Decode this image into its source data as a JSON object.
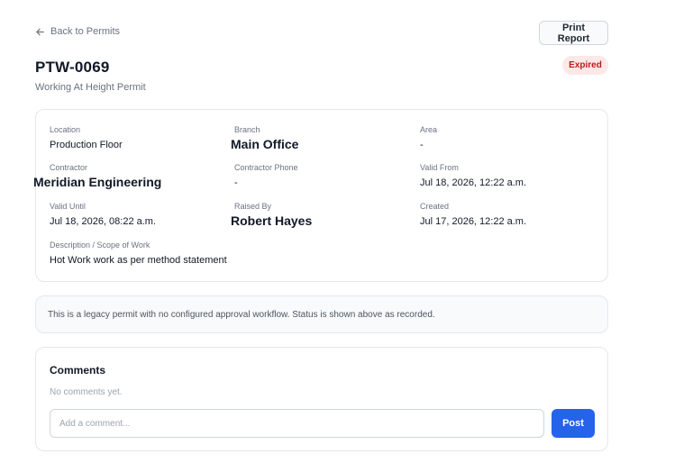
{
  "nav": {
    "back_label": "Back to Permits",
    "print_label": "Print Report"
  },
  "permit": {
    "id": "PTW-0069",
    "type": "Working At Height Permit",
    "status": "Expired"
  },
  "details": {
    "location": {
      "label": "Location",
      "value": "Production Floor"
    },
    "branch": {
      "label": "Branch",
      "value": "Main Office"
    },
    "area": {
      "label": "Area",
      "value": "-"
    },
    "contractor": {
      "label": "Contractor",
      "value": "Meridian Engineering"
    },
    "contractor_phone": {
      "label": "Contractor Phone",
      "value": "-"
    },
    "valid_from": {
      "label": "Valid From",
      "value": "Jul 18, 2026, 12:22 a.m."
    },
    "valid_until": {
      "label": "Valid Until",
      "value": "Jul 18, 2026, 08:22 a.m."
    },
    "raised_by": {
      "label": "Raised By",
      "value": "Robert Hayes"
    },
    "created": {
      "label": "Created",
      "value": "Jul 17, 2026, 12:22 a.m."
    },
    "description": {
      "label": "Description / Scope of Work",
      "value": "Hot Work work as per method statement"
    }
  },
  "workflow_note": "This is a legacy permit with no configured approval workflow. Status is shown above as recorded.",
  "comments": {
    "title": "Comments",
    "empty_text": "No comments yet.",
    "input_value": "",
    "input_placeholder": "Add a comment...",
    "post_label": "Post"
  },
  "colors": {
    "accent": "#2563eb",
    "status_bg": "#fde8e8",
    "status_text": "#b91c1c"
  }
}
